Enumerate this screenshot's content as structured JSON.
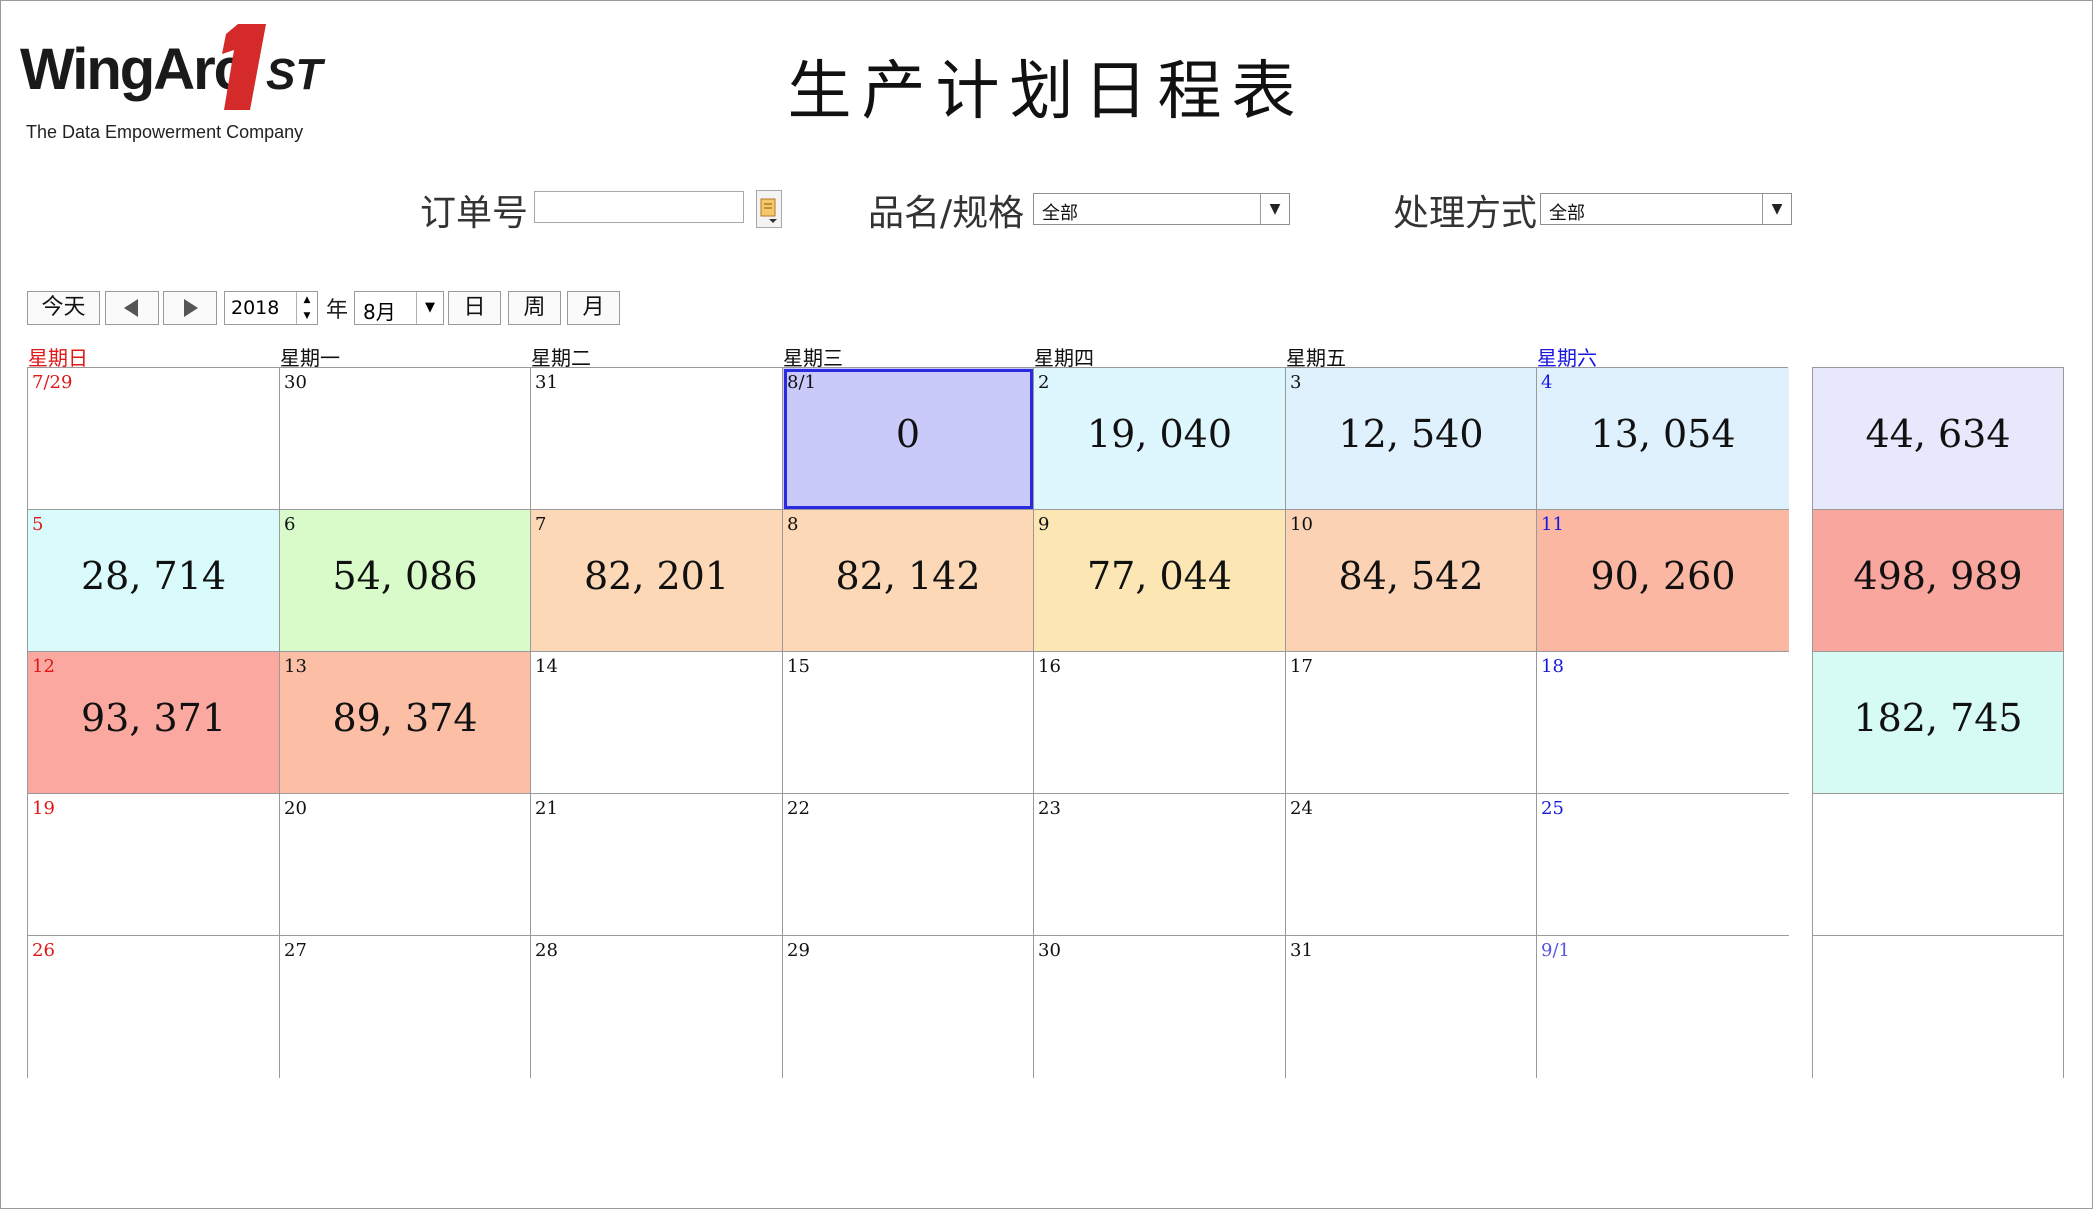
{
  "logo": {
    "wordmark": "WingArc",
    "one": "1",
    "st": "ST",
    "tagline": "The Data Empowerment Company",
    "red_color": "#d42a2a"
  },
  "title": "生产计划日程表",
  "filters": {
    "order_label": "订单号",
    "order_value": "",
    "product_label": "品名/规格",
    "product_value": "全部",
    "method_label": "处理方式",
    "method_value": "全部"
  },
  "toolbar": {
    "today": "今天",
    "year": "2018",
    "year_suffix": "年",
    "month": "8月",
    "day_view": "日",
    "week_view": "周",
    "month_view": "月"
  },
  "weekdays": [
    "星期日",
    "星期一",
    "星期二",
    "星期三",
    "星期四",
    "星期五",
    "星期六"
  ],
  "colors": {
    "sunday": "#e01818",
    "saturday": "#1818e0",
    "other_month_saturday": "#5555dd"
  },
  "weeks": [
    {
      "days": [
        {
          "label": "7/29",
          "value": "",
          "bg": "#ffffff"
        },
        {
          "label": "30",
          "value": "",
          "bg": "#ffffff"
        },
        {
          "label": "31",
          "value": "",
          "bg": "#ffffff"
        },
        {
          "label": "8/1",
          "value": "0",
          "bg": "#c9c9fa",
          "selected": true
        },
        {
          "label": "2",
          "value": "19, 040",
          "bg": "#def6fd"
        },
        {
          "label": "3",
          "value": "12, 540",
          "bg": "#def1fd"
        },
        {
          "label": "4",
          "value": "13, 054",
          "bg": "#def1fd"
        }
      ],
      "total": "44, 634",
      "total_bg": "#e8e8fc"
    },
    {
      "days": [
        {
          "label": "5",
          "value": "28, 714",
          "bg": "#d9fbfb"
        },
        {
          "label": "6",
          "value": "54, 086",
          "bg": "#d8fbc9"
        },
        {
          "label": "7",
          "value": "82, 201",
          "bg": "#fcd8b6"
        },
        {
          "label": "8",
          "value": "82, 142",
          "bg": "#fcd8b6"
        },
        {
          "label": "9",
          "value": "77, 044",
          "bg": "#fce6b4"
        },
        {
          "label": "10",
          "value": "84, 542",
          "bg": "#fcd2b4"
        },
        {
          "label": "11",
          "value": "90, 260",
          "bg": "#fcb7a2"
        }
      ],
      "total": "498, 989",
      "total_bg": "#f9a79e"
    },
    {
      "days": [
        {
          "label": "12",
          "value": "93, 371",
          "bg": "#fba8a0"
        },
        {
          "label": "13",
          "value": "89, 374",
          "bg": "#fcbfa6"
        },
        {
          "label": "14",
          "value": "",
          "bg": "#ffffff"
        },
        {
          "label": "15",
          "value": "",
          "bg": "#ffffff"
        },
        {
          "label": "16",
          "value": "",
          "bg": "#ffffff"
        },
        {
          "label": "17",
          "value": "",
          "bg": "#ffffff"
        },
        {
          "label": "18",
          "value": "",
          "bg": "#ffffff"
        }
      ],
      "total": "182, 745",
      "total_bg": "#d6faf4"
    },
    {
      "days": [
        {
          "label": "19",
          "value": "",
          "bg": "#ffffff"
        },
        {
          "label": "20",
          "value": "",
          "bg": "#ffffff"
        },
        {
          "label": "21",
          "value": "",
          "bg": "#ffffff"
        },
        {
          "label": "22",
          "value": "",
          "bg": "#ffffff"
        },
        {
          "label": "23",
          "value": "",
          "bg": "#ffffff"
        },
        {
          "label": "24",
          "value": "",
          "bg": "#ffffff"
        },
        {
          "label": "25",
          "value": "",
          "bg": "#ffffff"
        }
      ],
      "total": "",
      "total_bg": "#ffffff"
    },
    {
      "days": [
        {
          "label": "26",
          "value": "",
          "bg": "#ffffff"
        },
        {
          "label": "27",
          "value": "",
          "bg": "#ffffff"
        },
        {
          "label": "28",
          "value": "",
          "bg": "#ffffff"
        },
        {
          "label": "29",
          "value": "",
          "bg": "#ffffff"
        },
        {
          "label": "30",
          "value": "",
          "bg": "#ffffff"
        },
        {
          "label": "31",
          "value": "",
          "bg": "#ffffff"
        },
        {
          "label": "9/1",
          "value": "",
          "bg": "#ffffff"
        }
      ],
      "total": "",
      "total_bg": "#ffffff"
    }
  ]
}
